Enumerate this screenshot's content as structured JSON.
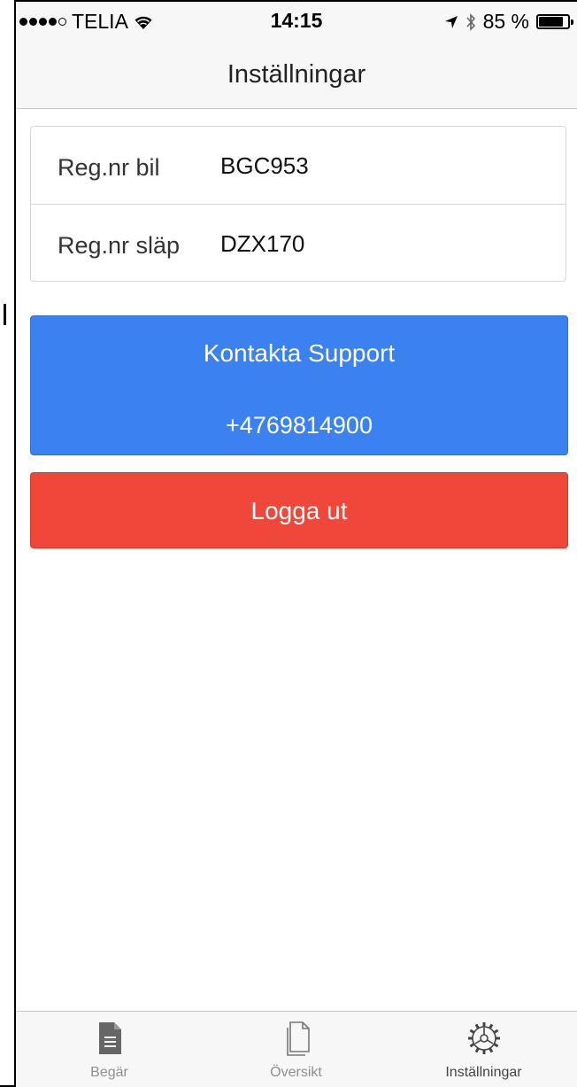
{
  "statusbar": {
    "carrier": "TELIA",
    "time": "14:15",
    "battery_percent": "85 %",
    "battery_level": 0.85,
    "icons": [
      "signal-dots-icon",
      "wifi-icon",
      "location-arrow-icon",
      "bluetooth-icon",
      "battery-icon"
    ]
  },
  "navbar": {
    "title": "Inställningar"
  },
  "settings": {
    "rows": [
      {
        "label": "Reg.nr bil",
        "value": "BGC953"
      },
      {
        "label": "Reg.nr släp",
        "value": "DZX170"
      }
    ]
  },
  "support": {
    "title": "Kontakta Support",
    "phone": "+4769814900",
    "color": "#3b82f0"
  },
  "logout": {
    "label": "Logga ut",
    "color": "#f0473b"
  },
  "tabbar": {
    "tabs": [
      {
        "label": "Begär",
        "icon": "document-icon",
        "active": false
      },
      {
        "label": "Översikt",
        "icon": "copy-documents-icon",
        "active": false
      },
      {
        "label": "Inställningar",
        "icon": "gear-icon",
        "active": true
      }
    ]
  }
}
